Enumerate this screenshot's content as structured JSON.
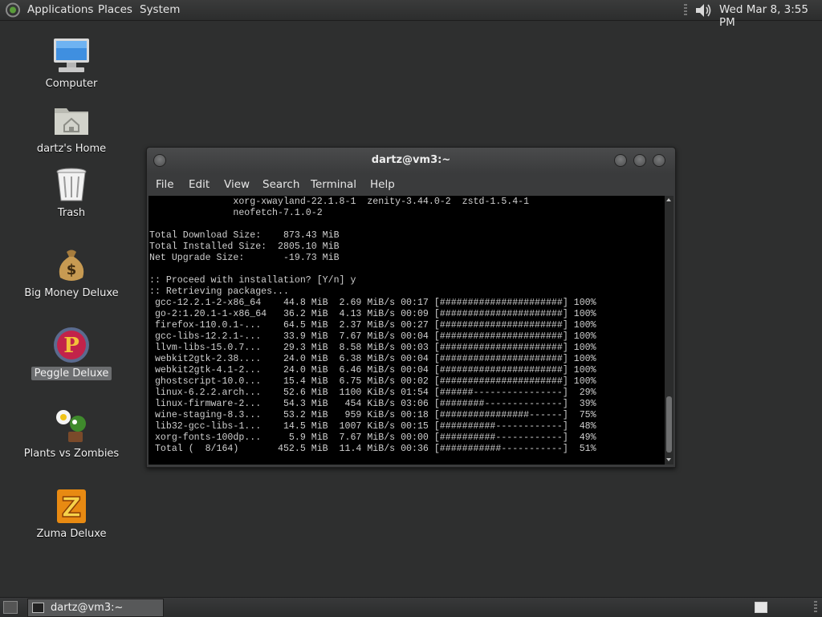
{
  "top_panel": {
    "menus": [
      "Applications",
      "Places",
      "System"
    ],
    "clock": "Wed Mar  8,  3:55 PM"
  },
  "desktop": {
    "icons": [
      {
        "label": "Computer",
        "icon": "computer-icon"
      },
      {
        "label": "dartz's Home",
        "icon": "home-folder-icon"
      },
      {
        "label": "Trash",
        "icon": "trash-icon"
      },
      {
        "label": "Big Money Deluxe",
        "icon": "money-bag-icon"
      },
      {
        "label": "Peggle Deluxe",
        "icon": "peggle-icon",
        "selected": true
      },
      {
        "label": "Plants vs Zombies",
        "icon": "plants-icon"
      },
      {
        "label": "Zuma Deluxe",
        "icon": "zuma-icon"
      }
    ]
  },
  "terminal": {
    "title": "dartz@vm3:~",
    "menu": [
      "File",
      "Edit",
      "View",
      "Search",
      "Terminal",
      "Help"
    ],
    "lines": [
      "               xorg-xwayland-22.1.8-1  zenity-3.44.0-2  zstd-1.5.4-1",
      "               neofetch-7.1.0-2",
      "",
      "Total Download Size:    873.43 MiB",
      "Total Installed Size:  2805.10 MiB",
      "Net Upgrade Size:       -19.73 MiB",
      "",
      ":: Proceed with installation? [Y/n] y",
      ":: Retrieving packages...",
      " gcc-12.2.1-2-x86_64    44.8 MiB  2.69 MiB/s 00:17 [######################] 100%",
      " go-2:1.20.1-1-x86_64   36.2 MiB  4.13 MiB/s 00:09 [######################] 100%",
      " firefox-110.0.1-...    64.5 MiB  2.37 MiB/s 00:27 [######################] 100%",
      " gcc-libs-12.2.1-...    33.9 MiB  7.67 MiB/s 00:04 [######################] 100%",
      " llvm-libs-15.0.7...    29.3 MiB  8.58 MiB/s 00:03 [######################] 100%",
      " webkit2gtk-2.38....    24.0 MiB  6.38 MiB/s 00:04 [######################] 100%",
      " webkit2gtk-4.1-2...    24.0 MiB  6.46 MiB/s 00:04 [######################] 100%",
      " ghostscript-10.0...    15.4 MiB  6.75 MiB/s 00:02 [######################] 100%",
      " linux-6.2.2.arch...    52.6 MiB  1100 KiB/s 01:54 [######----------------]  29%",
      " linux-firmware-2...    54.3 MiB   454 KiB/s 03:06 [########--------------]  39%",
      " wine-staging-8.3...    53.2 MiB   959 KiB/s 00:18 [################------]  75%",
      " lib32-gcc-libs-1...    14.5 MiB  1007 KiB/s 00:15 [##########------------]  48%",
      " xorg-fonts-100dp...     5.9 MiB  7.67 MiB/s 00:00 [##########------------]  49%",
      " Total (  8/164)       452.5 MiB  11.4 MiB/s 00:36 [###########-----------]  51%"
    ]
  },
  "taskbar": {
    "tasks": [
      {
        "label": "dartz@vm3:~",
        "icon": "terminal-icon"
      }
    ]
  }
}
